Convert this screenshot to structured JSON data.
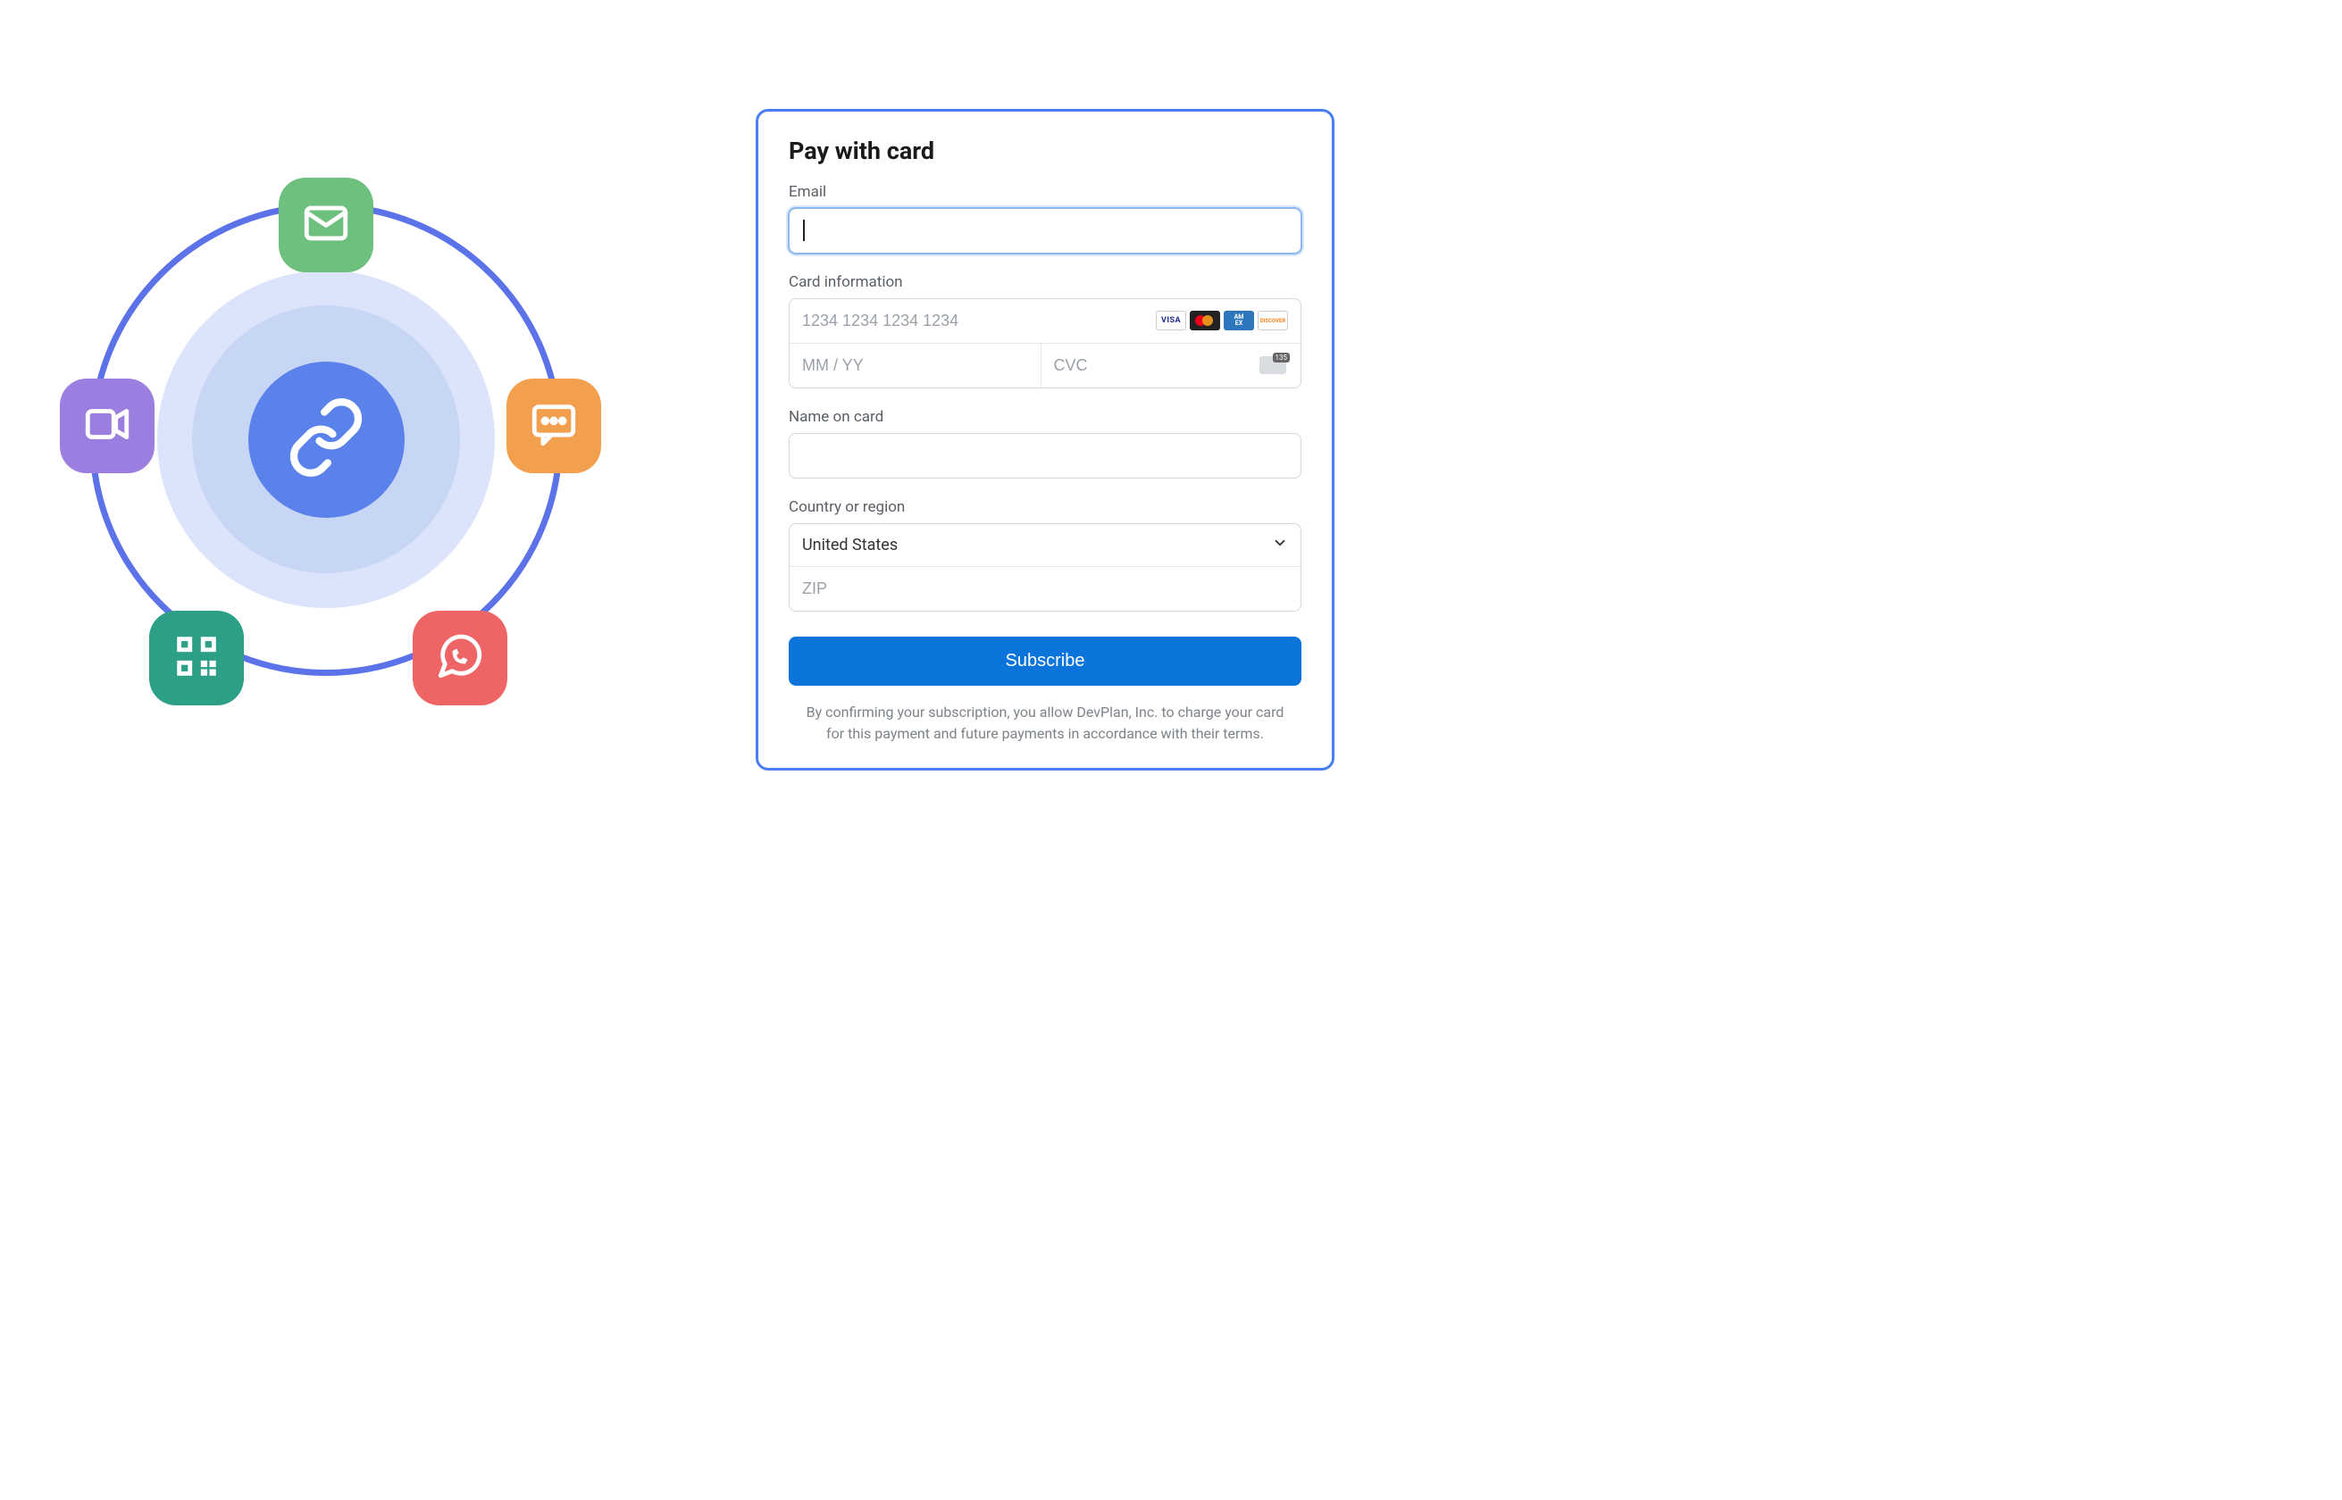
{
  "diagram": {
    "center_icon": "link-icon",
    "pills": [
      {
        "name": "email-icon",
        "color": "#6ec07e"
      },
      {
        "name": "video-icon",
        "color": "#9b7ee0"
      },
      {
        "name": "chat-icon",
        "color": "#f2a04e"
      },
      {
        "name": "qr-icon",
        "color": "#2c9f87"
      },
      {
        "name": "whatsapp-icon",
        "color": "#ef6565"
      }
    ]
  },
  "form": {
    "title": "Pay with card",
    "email_label": "Email",
    "email_value": "",
    "card_label": "Card information",
    "card_number_placeholder": "1234 1234 1234 1234",
    "card_exp_placeholder": "MM / YY",
    "card_cvc_placeholder": "CVC",
    "card_brands": [
      "VISA",
      "mastercard",
      "AMEX",
      "DISCOVER"
    ],
    "name_label": "Name on card",
    "name_value": "",
    "country_label": "Country or region",
    "country_selected": "United States",
    "zip_placeholder": "ZIP",
    "subscribe_label": "Subscribe",
    "fine_print": "By confirming your subscription, you allow DevPlan, Inc. to charge your card for this payment and future payments in accordance with their terms."
  },
  "colors": {
    "accent": "#4a7ef5",
    "button": "#0a74db"
  }
}
